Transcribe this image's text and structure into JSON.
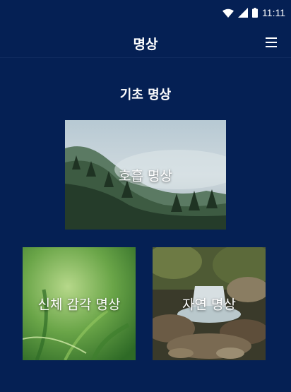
{
  "status_bar": {
    "time": "11:11"
  },
  "app_bar": {
    "title": "명상"
  },
  "section": {
    "title": "기초 명상"
  },
  "cards": [
    {
      "label": "호흡 명상",
      "image": "misty-forest-mountain"
    },
    {
      "label": "신체 감각 명상",
      "image": "green-grass-closeup"
    },
    {
      "label": "자연 명상",
      "image": "waterfall-stream-rocks"
    }
  ],
  "colors": {
    "background": "#052054",
    "text": "#ffffff"
  }
}
